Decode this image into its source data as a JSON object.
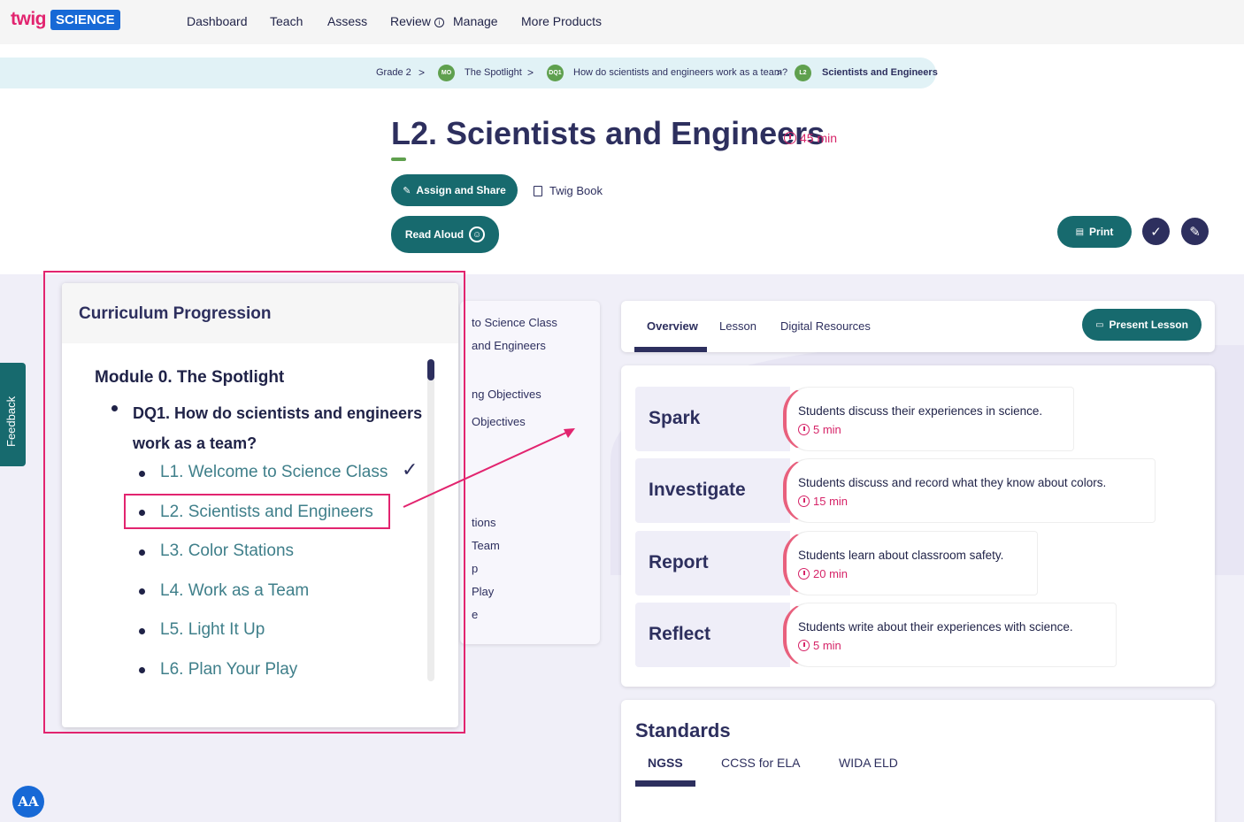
{
  "header": {
    "logo_twig": "twig",
    "logo_science": "SCIENCE",
    "nav": [
      {
        "label": "Dashboard"
      },
      {
        "label": "Teach"
      },
      {
        "label": "Assess"
      },
      {
        "label": "Review"
      },
      {
        "label": "Manage"
      },
      {
        "label": "More Products"
      }
    ],
    "review_info_icon": "info-icon"
  },
  "breadcrumb": {
    "items": [
      {
        "label": "Grade 2"
      },
      {
        "badge": "MO",
        "label": "The Spotlight"
      },
      {
        "badge": "DQ1",
        "label": "How do scientists and engineers work as a team?"
      },
      {
        "badge": "L2",
        "label": "Scientists and Engineers"
      }
    ],
    "separator": ">"
  },
  "lesson": {
    "title": "L2. Scientists and Engineers",
    "duration": "45 min",
    "assign_label": "Assign and Share",
    "twig_book_label": "Twig Book",
    "read_aloud_label": "Read Aloud",
    "print_label": "Print"
  },
  "feedback": {
    "label": "Feedback"
  },
  "sidenav": {
    "items": [
      {
        "label": "to Science Class"
      },
      {
        "label": "and Engineers"
      },
      {
        "label": "ng Objectives"
      },
      {
        "label": "Objectives"
      },
      {
        "label": "tions"
      },
      {
        "label": "Team"
      },
      {
        "label": "p"
      },
      {
        "label": "Play"
      },
      {
        "label": "e"
      }
    ]
  },
  "curriculum": {
    "title": "Curriculum Progression",
    "module": "Module 0. The Spotlight",
    "dq": "DQ1. How do scientists and engineers work as a team?",
    "lessons": [
      {
        "label": "L1. Welcome to Science Class",
        "completed": true
      },
      {
        "label": "L2. Scientists and Engineers",
        "highlighted": true
      },
      {
        "label": "L3. Color Stations"
      },
      {
        "label": "L4. Work as a Team"
      },
      {
        "label": "L5. Light It Up"
      },
      {
        "label": "L6. Plan Your Play"
      }
    ]
  },
  "tabs": {
    "items": [
      {
        "label": "Overview",
        "active": true
      },
      {
        "label": "Lesson"
      },
      {
        "label": "Digital Resources"
      }
    ],
    "present_label": "Present Lesson"
  },
  "phases": [
    {
      "name": "Spark",
      "desc": "Students discuss their experiences in science.",
      "time": "5 min"
    },
    {
      "name": "Investigate",
      "desc": "Students discuss and record what they know about colors.",
      "time": "15 min"
    },
    {
      "name": "Report",
      "desc": "Students learn about classroom safety.",
      "time": "20 min"
    },
    {
      "name": "Reflect",
      "desc": "Students write about their experiences with science.",
      "time": "5 min"
    }
  ],
  "standards": {
    "title": "Standards",
    "tabs": [
      {
        "label": "NGSS",
        "active": true
      },
      {
        "label": "CCSS for ELA"
      },
      {
        "label": "WIDA ELD"
      }
    ]
  },
  "accessibility": {
    "label": "AA"
  },
  "colors": {
    "brand_teal": "#176a6e",
    "brand_navy": "#2d2f5e",
    "highlight_pink": "#e2246f",
    "module_green": "#5fa04e"
  }
}
